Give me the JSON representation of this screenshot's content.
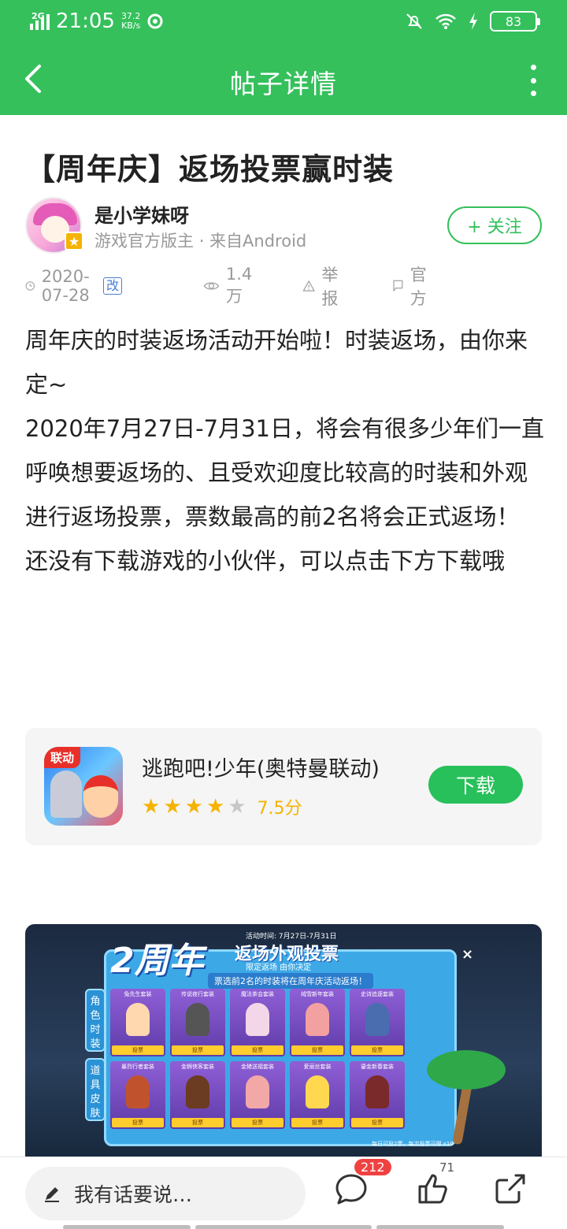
{
  "status_bar": {
    "network": "2G",
    "time": "21:05",
    "speed_value": "37.2",
    "speed_unit": "KB/s",
    "battery": "83"
  },
  "nav": {
    "title": "帖子详情"
  },
  "post": {
    "title": "【周年庆】返场投票赢时装",
    "author": {
      "name": "是小学妹呀",
      "role": "游戏官方版主",
      "source": "来自Android",
      "follow_label": "+ 关注"
    },
    "info": {
      "date": "2020-07-28",
      "edited_tag": "改",
      "views": "1.4万",
      "report": "举报",
      "tag": "官方"
    },
    "paragraphs": [
      "周年庆的时装返场活动开始啦！时装返场，由你来定~",
      "2020年7月27日-7月31日，将会有很多少年们一直呼唤想要返场的、且受欢迎度比较高的时装和外观进行返场投票，票数最高的前2名将会正式返场！",
      "还没有下载游戏的小伙伴，可以点击下方下载哦"
    ]
  },
  "app_card": {
    "icon_tag": "联动",
    "name": "逃跑吧!少年(奥特曼联动)",
    "rating_stars": 4,
    "rating_max": 5,
    "score": "7.5分",
    "download_label": "下载"
  },
  "banner": {
    "logo": "2周年",
    "title": "返场外观投票",
    "date": "活动时间: 7月27日-7月31日",
    "slogan": "限定返场 由你决定",
    "notice": "票选前2名的时装将在周年庆活动返场！",
    "close": "×",
    "side_tabs": [
      "角色时装",
      "道具皮肤"
    ],
    "vote_label": "投票",
    "items_row1": [
      "兔先生套装",
      "传说夜行套装",
      "魔法茶会套装",
      "绒雪新年套装",
      "史诗追逐套装"
    ],
    "items_row2": [
      "暴烈行者套装",
      "金狮侠客套装",
      "金猪送福套装",
      "爱丽丝套装",
      "鎏金新春套装"
    ],
    "footer": "每日可投2票，每次投票可得 x10"
  },
  "bottom_bar": {
    "comment_placeholder": "我有话要说…",
    "comment_count": "212",
    "like_count": "71"
  },
  "colors": {
    "brand_green": "#35c05c",
    "download_green": "#27c05a",
    "star": "#f5b300",
    "badge_red": "#f04141"
  }
}
